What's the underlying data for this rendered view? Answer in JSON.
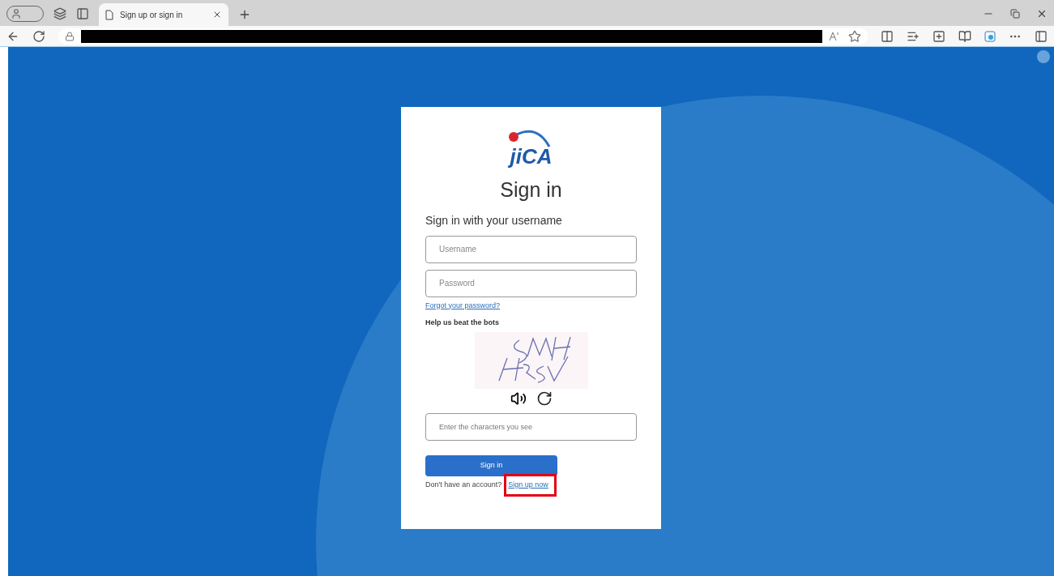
{
  "browser": {
    "tab": {
      "title": "Sign up or sign in",
      "selected": true
    }
  },
  "card": {
    "logo": "jiCA",
    "title": "Sign in",
    "subtitle": "Sign in with your username",
    "fields": [
      {
        "placeholder": "Username"
      },
      {
        "placeholder": "Password"
      }
    ],
    "forgot_link": "Forgot your password?",
    "captcha": {
      "label": "Help us beat the bots",
      "input_placeholder": "Enter the characters you see"
    },
    "submit": "Sign in",
    "signup_prompt": "Don't have an account?",
    "signup_link": "Sign up now",
    "signup_highlighted": true
  }
}
